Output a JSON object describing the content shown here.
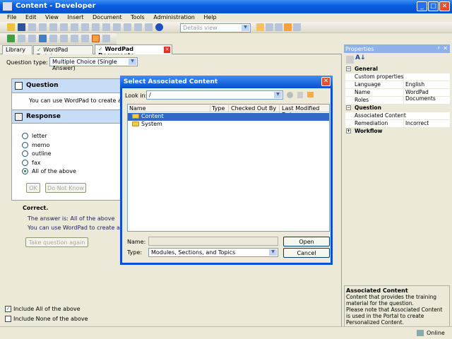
{
  "window": {
    "title": "Content - Developer"
  },
  "menu": [
    "File",
    "Edit",
    "View",
    "Insert",
    "Document",
    "Tools",
    "Administration",
    "Help"
  ],
  "toolbar": {
    "view_select": "Details view"
  },
  "tabs": [
    {
      "label": "Library"
    },
    {
      "label": "WordPad Training"
    },
    {
      "label": "WordPad Documents",
      "active": true
    }
  ],
  "editor": {
    "question_type_label": "Question type:",
    "question_type_value": "Multiple Choice (Single Answer)",
    "question_header": "Question",
    "question_text": "You can use WordPad to create a",
    "response_header": "Response",
    "options": [
      {
        "label": "letter",
        "selected": false
      },
      {
        "label": "memo",
        "selected": false
      },
      {
        "label": "outline",
        "selected": false
      },
      {
        "label": "fax",
        "selected": false
      },
      {
        "label": "All of the above",
        "selected": true
      }
    ],
    "ok_button": "OK",
    "dont_know_button": "Do Not Know",
    "feedback_title": "Correct.",
    "feedback_answer": "The answer is: All of the above",
    "feedback_text": "You can use WordPad to create any",
    "retake_button": "Take question again",
    "include_all": {
      "label": "Include All of the above",
      "checked": true
    },
    "include_none": {
      "label": "Include None of the above",
      "checked": false
    }
  },
  "properties": {
    "title": "Properties",
    "categories": [
      {
        "name": "General",
        "expanded": true,
        "rows": [
          {
            "k": "Custom properties",
            "v": ""
          },
          {
            "k": "Language",
            "v": "English"
          },
          {
            "k": "Name",
            "v": "WordPad Documents"
          },
          {
            "k": "Roles",
            "v": ""
          }
        ]
      },
      {
        "name": "Question",
        "expanded": true,
        "rows": [
          {
            "k": "Associated Content",
            "v": ""
          },
          {
            "k": "Remediation",
            "v": "Incorrect"
          }
        ]
      },
      {
        "name": "Workflow",
        "expanded": false,
        "rows": []
      }
    ],
    "desc_title": "Associated Content",
    "desc_text": "Content that provides the training material for the question.",
    "desc_note": "Please note that Associated Content is used in the Portal to create Personalized Content."
  },
  "dialog": {
    "title": "Select Associated Content",
    "look_in_label": "Look in:",
    "look_in_value": "/",
    "columns": [
      "Name",
      "Type",
      "Checked Out By",
      "Last Modified Date"
    ],
    "items": [
      {
        "name": "Content",
        "selected": true
      },
      {
        "name": "System",
        "selected": false
      }
    ],
    "name_label": "Name:",
    "name_value": "",
    "type_label": "Type:",
    "type_value": "Modules, Sections, and Topics",
    "open_button": "Open",
    "cancel_button": "Cancel"
  },
  "status": {
    "online": "Online"
  },
  "colors": {
    "titlebar": "#0a5ee0",
    "selection": "#316ac5",
    "panel_header": "#c7dcf5"
  }
}
